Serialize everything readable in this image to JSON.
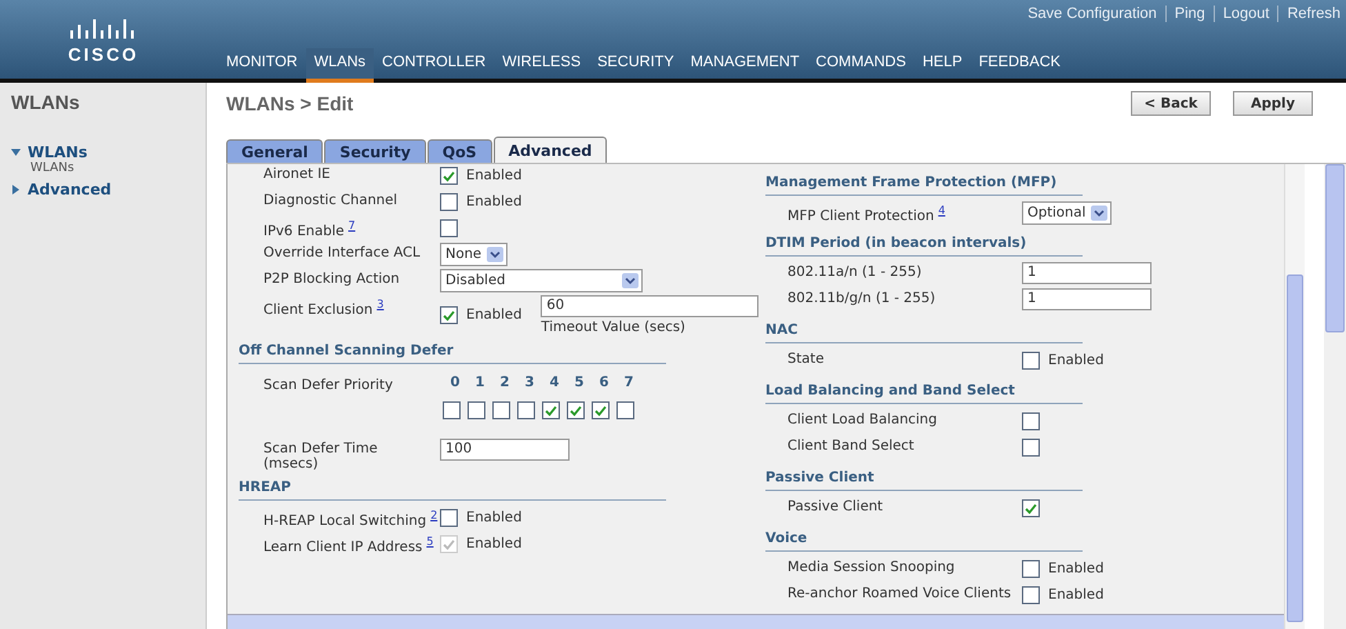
{
  "header": {
    "logo": "CISCO",
    "top_links": [
      "Save Configuration",
      "Ping",
      "Logout",
      "Refresh"
    ],
    "nav": [
      {
        "label": "MONITOR",
        "selected": false
      },
      {
        "label": "WLANs",
        "selected": true
      },
      {
        "label": "CONTROLLER",
        "selected": false
      },
      {
        "label": "WIRELESS",
        "selected": false
      },
      {
        "label": "SECURITY",
        "selected": false
      },
      {
        "label": "MANAGEMENT",
        "selected": false
      },
      {
        "label": "COMMANDS",
        "selected": false
      },
      {
        "label": "HELP",
        "selected": false
      },
      {
        "label": "FEEDBACK",
        "selected": false
      }
    ]
  },
  "sidebar": {
    "title": "WLANs",
    "items": [
      {
        "label": "WLANs",
        "expanded": true,
        "children": [
          {
            "label": "WLANs"
          }
        ]
      },
      {
        "label": "Advanced",
        "expanded": false
      }
    ]
  },
  "page": {
    "title": "WLANs > Edit",
    "buttons": [
      "< Back",
      "Apply"
    ]
  },
  "tabs": [
    {
      "label": "General",
      "selected": false
    },
    {
      "label": "Security",
      "selected": false
    },
    {
      "label": "QoS",
      "selected": false
    },
    {
      "label": "Advanced",
      "selected": true
    }
  ],
  "left": [
    {
      "kind": "row",
      "label": "Aironet IE",
      "control": {
        "kind": "checkbox",
        "checked": true,
        "disabled": false,
        "text": "Enabled"
      }
    },
    {
      "kind": "row",
      "label": "Diagnostic Channel",
      "control": {
        "kind": "checkbox",
        "checked": false,
        "disabled": false,
        "text": "Enabled"
      }
    },
    {
      "kind": "row",
      "label": "IPv6 Enable",
      "note": "7",
      "control": {
        "kind": "checkbox",
        "checked": false,
        "disabled": false
      }
    },
    {
      "kind": "row",
      "label": "Override Interface ACL",
      "control": {
        "kind": "select",
        "value": "None",
        "wide": false
      }
    },
    {
      "kind": "row",
      "label": "P2P Blocking Action",
      "control": {
        "kind": "select",
        "value": "Disabled",
        "wide": true
      }
    },
    {
      "kind": "row",
      "label": "Client Exclusion",
      "note": "3",
      "control": {
        "kind": "exclusion",
        "checked": true,
        "disabled": false,
        "text": "Enabled",
        "value": "60",
        "caption": "Timeout Value (secs)"
      }
    },
    {
      "kind": "heading",
      "label": "Off Channel Scanning Defer"
    },
    {
      "kind": "priority",
      "label": "Scan Defer Priority",
      "levels": [
        {
          "label": "0",
          "checked": false
        },
        {
          "label": "1",
          "checked": false
        },
        {
          "label": "2",
          "checked": false
        },
        {
          "label": "3",
          "checked": false
        },
        {
          "label": "4",
          "checked": true
        },
        {
          "label": "5",
          "checked": true
        },
        {
          "label": "6",
          "checked": true
        },
        {
          "label": "7",
          "checked": false
        }
      ]
    },
    {
      "kind": "row",
      "label": "Scan Defer Time",
      "sublabel": "(msecs)",
      "control": {
        "kind": "input",
        "value": "100"
      }
    },
    {
      "kind": "heading",
      "label": "HREAP"
    },
    {
      "kind": "row",
      "label": "H-REAP Local Switching",
      "note": "2",
      "control": {
        "kind": "checkbox",
        "checked": false,
        "disabled": false,
        "text": "Enabled"
      }
    },
    {
      "kind": "row",
      "label": "Learn Client IP Address",
      "note": "5",
      "control": {
        "kind": "checkbox",
        "checked": true,
        "disabled": true,
        "text": "Enabled"
      }
    }
  ],
  "right": [
    {
      "kind": "heading",
      "label": "Management Frame Protection (MFP)"
    },
    {
      "kind": "row",
      "label": "MFP Client Protection",
      "note": "4",
      "control": {
        "kind": "select",
        "value": "Optional",
        "wide": false
      }
    },
    {
      "kind": "heading",
      "label": "DTIM Period (in beacon intervals)"
    },
    {
      "kind": "row",
      "label": "802.11a/n (1 - 255)",
      "control": {
        "kind": "input",
        "value": "1"
      }
    },
    {
      "kind": "row",
      "label": "802.11b/g/n (1 - 255)",
      "control": {
        "kind": "input",
        "value": "1"
      }
    },
    {
      "kind": "heading",
      "label": "NAC"
    },
    {
      "kind": "row",
      "label": "State",
      "control": {
        "kind": "checkbox",
        "checked": false,
        "disabled": false,
        "text": "Enabled"
      }
    },
    {
      "kind": "heading",
      "label": "Load Balancing and Band Select"
    },
    {
      "kind": "row",
      "label": "Client Load Balancing",
      "control": {
        "kind": "checkbox",
        "checked": false,
        "disabled": false
      }
    },
    {
      "kind": "row",
      "label": "Client Band Select",
      "control": {
        "kind": "checkbox",
        "checked": false,
        "disabled": false
      }
    },
    {
      "kind": "heading",
      "label": "Passive Client"
    },
    {
      "kind": "row",
      "label": "Passive Client",
      "control": {
        "kind": "checkbox",
        "checked": true,
        "disabled": false
      }
    },
    {
      "kind": "heading",
      "label": "Voice"
    },
    {
      "kind": "row",
      "label": "Media Session Snooping",
      "control": {
        "kind": "checkbox",
        "checked": false,
        "disabled": false,
        "text": "Enabled"
      }
    },
    {
      "kind": "row",
      "label": "Re-anchor Roamed Voice Clients",
      "control": {
        "kind": "checkbox",
        "checked": false,
        "disabled": false,
        "text": "Enabled"
      }
    }
  ]
}
